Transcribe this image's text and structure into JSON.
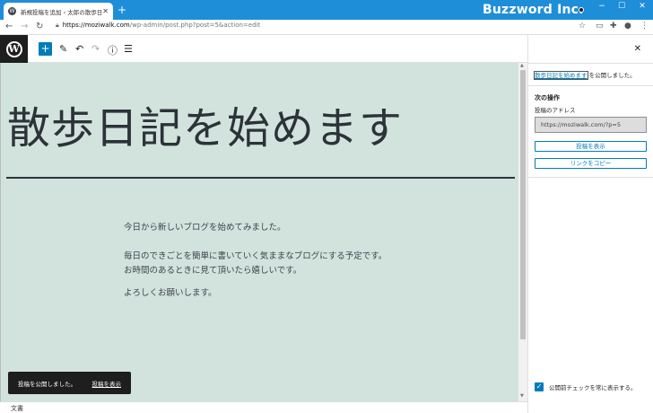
{
  "browser": {
    "tab_title": "新規投稿を追加 ‹ 太郎の散歩日記",
    "new_tab": "+",
    "brand": "Buzzword Inc.",
    "url_host": "https://moziwalk.com",
    "url_path": "/wp-admin/post.php?post=5&action=edit",
    "minimize": "−",
    "maximize": "☐",
    "close": "✕"
  },
  "editor": {
    "add_block": "+",
    "post_title": "散歩日記を始めます",
    "paragraphs": [
      "今日から新しいブログを始めてみました。",
      "毎日のできごとを簡単に書いていく気ままなブログにする予定です。お時間のあるときに見て頂いたら嬉しいです。",
      "よろしくお願いします。"
    ],
    "status": "文書"
  },
  "snackbar": {
    "message": "投稿を公開しました。",
    "action": "投稿を表示"
  },
  "panel": {
    "notice_link": "散歩日記を始めます",
    "notice_rest": " を公開しました。",
    "next_title": "次の操作",
    "address_label": "投稿のアドレス",
    "address_value": "https://moziwalk.com/?p=5",
    "view_button": "投稿を表示",
    "copy_button": "リンクをコピー",
    "precheck_label": "公開前チェックを常に表示する。"
  },
  "colors": {
    "browser_bar": "#1f8ed9",
    "canvas_bg": "#d2e3de",
    "accent": "#007cba"
  }
}
